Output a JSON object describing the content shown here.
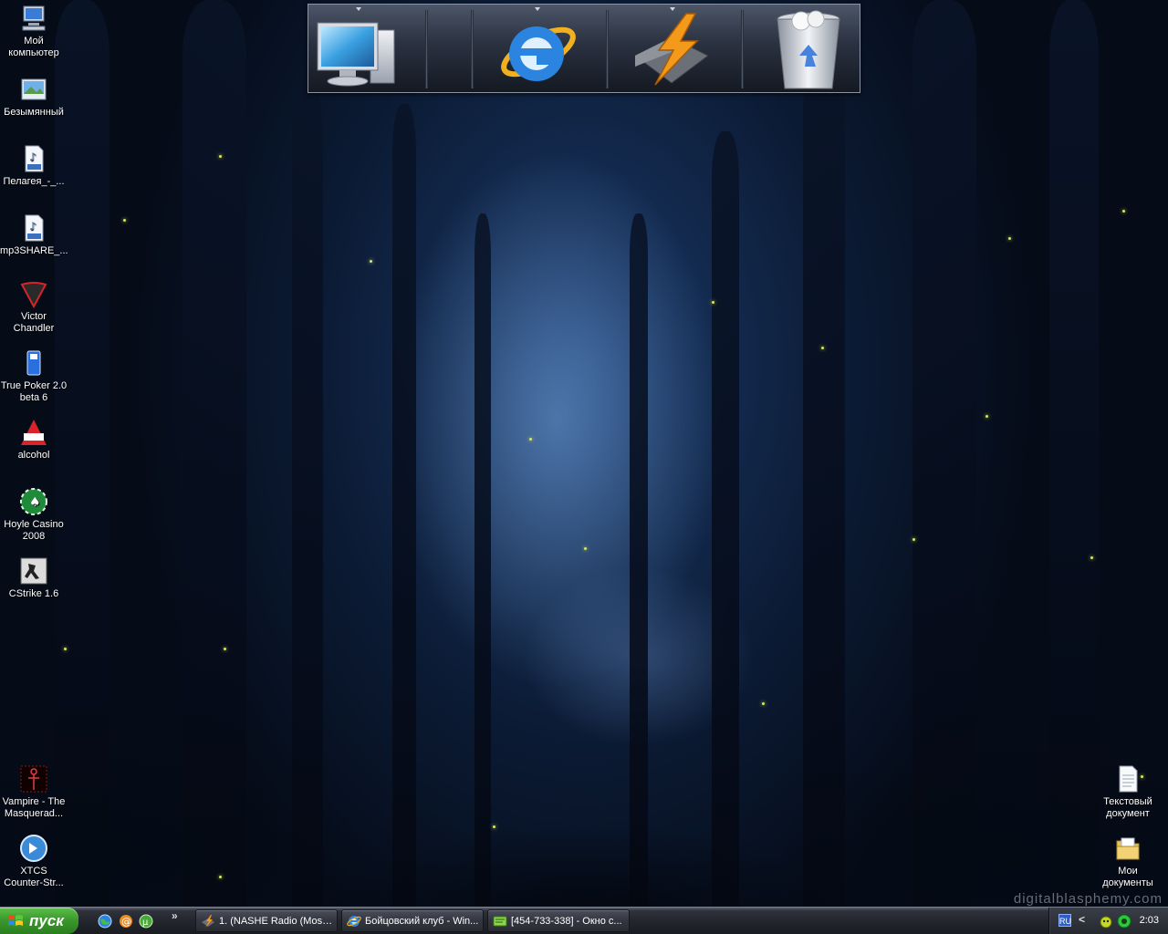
{
  "desktop": {
    "icons_left": [
      {
        "label": "Мой компьютер",
        "icon": "my-computer-icon"
      },
      {
        "label": "Безымянный",
        "icon": "image-file-icon"
      },
      {
        "label": "Пелагея_-_...",
        "icon": "mp3-file-icon"
      },
      {
        "label": "mp3SHARE_...",
        "icon": "mp3-file-icon"
      },
      {
        "label": "Victor Chandler",
        "icon": "victor-chandler-icon"
      },
      {
        "label": "True Poker 2.0 beta 6",
        "icon": "true-poker-icon"
      },
      {
        "label": "alcohol",
        "icon": "alcohol-120-icon"
      },
      {
        "label": "Hoyle Casino 2008",
        "icon": "hoyle-casino-icon"
      },
      {
        "label": "CStrike 1.6",
        "icon": "counter-strike-icon"
      },
      {
        "label": "Vampire - The Masquerad...",
        "icon": "vampire-game-icon"
      },
      {
        "label": "XTCS Counter-Str...",
        "icon": "xtcs-icon"
      }
    ],
    "icons_right": [
      {
        "label": "Текстовый документ",
        "icon": "text-document-icon"
      },
      {
        "label": "Мои документы",
        "icon": "my-documents-folder-icon"
      }
    ],
    "watermark": "digitalblasphemy.com"
  },
  "dock": {
    "items": [
      {
        "name": "my-computer",
        "icon": "monitor-icon"
      },
      {
        "name": "internet-explorer",
        "icon": "internet-explorer-icon"
      },
      {
        "name": "winamp",
        "icon": "winamp-icon"
      },
      {
        "name": "recycle-bin",
        "icon": "recycle-bin-icon"
      }
    ]
  },
  "taskbar": {
    "start_label": "пуск",
    "quick_launch": [
      {
        "icon": "browser-globe-icon"
      },
      {
        "icon": "mail-at-icon"
      },
      {
        "icon": "utorrent-icon"
      }
    ],
    "overflow_label": "»",
    "tasks": [
      {
        "label": "1. (NASHE Radio (Mosc...",
        "icon": "winamp-icon"
      },
      {
        "label": "Бойцовский клуб - Win...",
        "icon": "internet-explorer-icon"
      },
      {
        "label": "[454-733-338] - Окно с...",
        "icon": "icq-chat-icon"
      }
    ],
    "tray": {
      "language": "RU",
      "show_hidden_label": "<",
      "clock": "2:03"
    }
  },
  "colors": {
    "start_green": "#3a9a2c",
    "taskbar_dark": "#23262d",
    "firefly": "#d6e85a"
  }
}
